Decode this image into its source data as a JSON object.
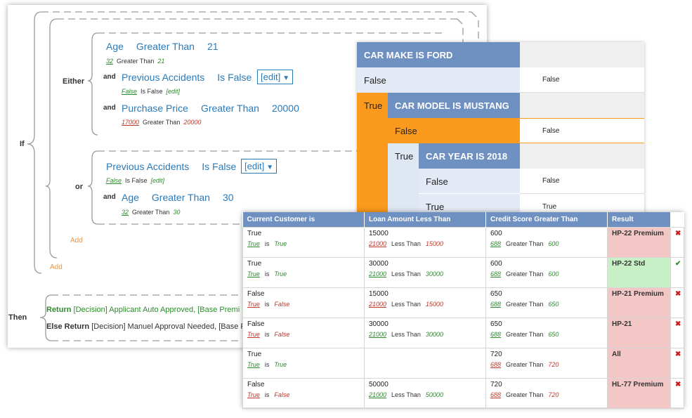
{
  "rule": {
    "if_label": "If",
    "either_label": "Either",
    "or_label": "or",
    "and_label": "and",
    "then_label": "Then",
    "add_label": "Add",
    "either_conditions": [
      {
        "field": "Age",
        "op": "Greater Than",
        "value": "21",
        "test_value": "32",
        "test_op": "Greater Than",
        "test_target": "21",
        "result": "pass"
      },
      {
        "field": "Previous Accidents",
        "op": "Is False",
        "value": "",
        "edit": "[edit]",
        "test_value": "False",
        "test_op": "Is False",
        "test_target": "[edit]",
        "result": "pass"
      },
      {
        "field": "Purchase Price",
        "op": "Greater Than",
        "value": "20000",
        "test_value": "17000",
        "test_op": "Greater Than",
        "test_target": "20000",
        "result": "fail"
      }
    ],
    "or_conditions": [
      {
        "field": "Previous Accidents",
        "op": "Is False",
        "value": "",
        "edit": "[edit]",
        "test_value": "False",
        "test_op": "Is False",
        "test_target": "[edit]",
        "result": "pass"
      },
      {
        "field": "Age",
        "op": "Greater Than",
        "value": "30",
        "test_value": "32",
        "test_op": "Greater Than",
        "test_target": "30",
        "result": "pass"
      }
    ],
    "then": {
      "return_label": "Return",
      "return_value": "[Decision] Applicant Auto Approved, [Base Premi",
      "else_label": "Else Return",
      "else_value": "[Decision] Manuel Approval Needed, [Base P"
    }
  },
  "tree": {
    "nodes": [
      {
        "title": "CAR MAKE IS FORD",
        "false_label": "False",
        "false_value": "False",
        "true_label": "True"
      },
      {
        "title": "CAR MODEL IS MUSTANG",
        "false_label": "False",
        "false_value": "False",
        "true_label": "True"
      },
      {
        "title": "CAR YEAR IS 2018",
        "false_label": "False",
        "false_value": "False",
        "true_label": "True",
        "true_value": "True"
      }
    ],
    "colors": {
      "header": "#6f91c2",
      "level1": "#fb9a1c",
      "level2": "#dfe7f3",
      "false_row": "#e4eaf5"
    }
  },
  "table": {
    "columns": [
      "Current Customer  is",
      "Loan Amount  Less Than",
      "Credit Score  Greater Than",
      "Result"
    ],
    "rows": [
      {
        "c1": {
          "v": "True",
          "t": "True",
          "op": "is",
          "tgt": "True",
          "ok": true
        },
        "c2": {
          "v": "15000",
          "t": "21000",
          "op": "Less Than",
          "tgt": "15000",
          "ok": false
        },
        "c3": {
          "v": "600",
          "t": "688",
          "op": "Greater Than",
          "tgt": "600",
          "ok": true
        },
        "result": "HP-22 Premium",
        "pass": false,
        "mark": "✖"
      },
      {
        "c1": {
          "v": "True",
          "t": "True",
          "op": "is",
          "tgt": "True",
          "ok": true
        },
        "c2": {
          "v": "30000",
          "t": "21000",
          "op": "Less Than",
          "tgt": "30000",
          "ok": true
        },
        "c3": {
          "v": "600",
          "t": "688",
          "op": "Greater Than",
          "tgt": "600",
          "ok": true
        },
        "result": "HP-22 Std",
        "pass": true,
        "mark": "✔"
      },
      {
        "c1": {
          "v": "False",
          "t": "True",
          "op": "is",
          "tgt": "False",
          "ok": false
        },
        "c2": {
          "v": "15000",
          "t": "21000",
          "op": "Less Than",
          "tgt": "15000",
          "ok": false
        },
        "c3": {
          "v": "650",
          "t": "688",
          "op": "Greater Than",
          "tgt": "650",
          "ok": true
        },
        "result": "HP-21 Premium",
        "pass": false,
        "mark": "✖"
      },
      {
        "c1": {
          "v": "False",
          "t": "True",
          "op": "is",
          "tgt": "False",
          "ok": false
        },
        "c2": {
          "v": "30000",
          "t": "21000",
          "op": "Less Than",
          "tgt": "30000",
          "ok": true
        },
        "c3": {
          "v": "650",
          "t": "688",
          "op": "Greater Than",
          "tgt": "650",
          "ok": true
        },
        "result": "HP-21",
        "pass": false,
        "mark": "✖"
      },
      {
        "c1": {
          "v": "True",
          "t": "True",
          "op": "is",
          "tgt": "True",
          "ok": true
        },
        "c2": null,
        "c3": {
          "v": "720",
          "t": "688",
          "op": "Greater Than",
          "tgt": "720",
          "ok": false
        },
        "result": "All",
        "pass": false,
        "mark": "✖"
      },
      {
        "c1": {
          "v": "False",
          "t": "True",
          "op": "is",
          "tgt": "False",
          "ok": false
        },
        "c2": {
          "v": "50000",
          "t": "21000",
          "op": "Less Than",
          "tgt": "50000",
          "ok": true
        },
        "c3": {
          "v": "720",
          "t": "688",
          "op": "Greater Than",
          "tgt": "720",
          "ok": false
        },
        "result": "HL-77 Premium",
        "pass": false,
        "mark": "✖"
      }
    ]
  }
}
